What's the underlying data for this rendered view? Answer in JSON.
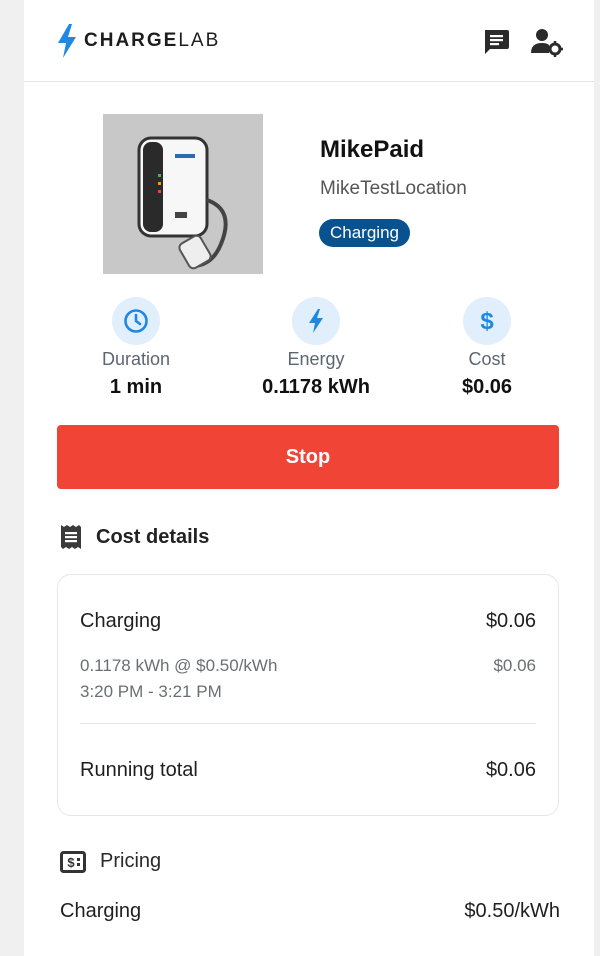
{
  "header": {
    "brand_bold": "CHARGE",
    "brand_light": "LAB"
  },
  "station": {
    "name": "MikePaid",
    "location": "MikeTestLocation",
    "status": "Charging"
  },
  "stats": [
    {
      "icon": "clock-icon",
      "label": "Duration",
      "value": "1 min"
    },
    {
      "icon": "lightning-icon",
      "label": "Energy",
      "value": "0.1178 kWh"
    },
    {
      "icon": "dollar-icon",
      "label": "Cost",
      "value": "$0.06"
    }
  ],
  "actions": {
    "stop_label": "Stop"
  },
  "cost_details": {
    "title": "Cost details",
    "item_label": "Charging",
    "item_amount": "$0.06",
    "detail_rate": "0.1178 kWh @ $0.50/kWh",
    "detail_time": "3:20 PM - 3:21 PM",
    "detail_amount": "$0.06",
    "total_label": "Running total",
    "total_amount": "$0.06"
  },
  "pricing": {
    "title": "Pricing",
    "label": "Charging",
    "rate": "$0.50/kWh"
  },
  "colors": {
    "accent_blue": "#1e88e5",
    "badge_blue": "#07528f",
    "stop_red": "#f04437",
    "icon_bg": "#e1eefb"
  }
}
